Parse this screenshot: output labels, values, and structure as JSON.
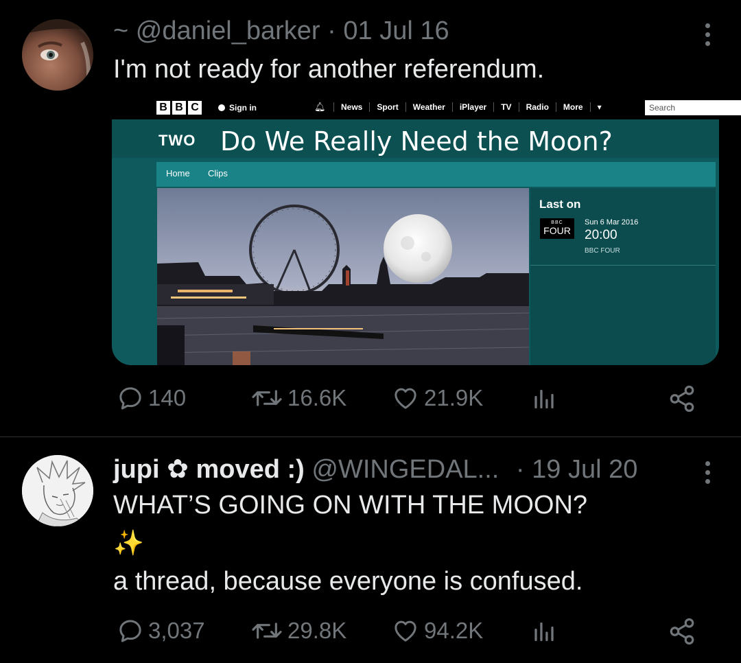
{
  "tweet1": {
    "handle": "~ @daniel_barker",
    "sep": "·",
    "date": "01 Jul 16",
    "text": "I'm not ready for another referendum.",
    "embed": {
      "bbc_logo": [
        "B",
        "B",
        "C"
      ],
      "sign_in": "Sign in",
      "nav": [
        "News",
        "Sport",
        "Weather",
        "iPlayer",
        "TV",
        "Radio",
        "More"
      ],
      "nav_more_caret": "▾",
      "search_placeholder": "Search",
      "channel": "TWO",
      "program_title": "Do We Really Need the Moon?",
      "subnav": [
        "Home",
        "Clips"
      ],
      "last_on": {
        "title": "Last on",
        "logo_small": "BBC",
        "logo_channel": "FOUR",
        "date": "Sun 6 Mar 2016",
        "time": "20:00",
        "channel": "BBC FOUR"
      }
    },
    "stats": {
      "replies": "140",
      "retweets": "16.6K",
      "likes": "21.9K"
    }
  },
  "tweet2": {
    "display_name": "jupi ✿ moved :)",
    "handle": "@WINGEDAL...",
    "sep": "·",
    "date": "19 Jul 20",
    "text_line1": "WHAT’S GOING ON WITH THE MOON?",
    "text_emoji": "✨",
    "text_line2": "a thread, because everyone is confused.",
    "stats": {
      "replies": "3,037",
      "retweets": "29.8K",
      "likes": "94.2K"
    }
  },
  "colors": {
    "background": "#000000",
    "text": "#e7e9ea",
    "muted": "#71767b",
    "divider": "#2f3336",
    "bbc_teal": "#0f5a5c",
    "bbc_teal_light": "#198388"
  }
}
